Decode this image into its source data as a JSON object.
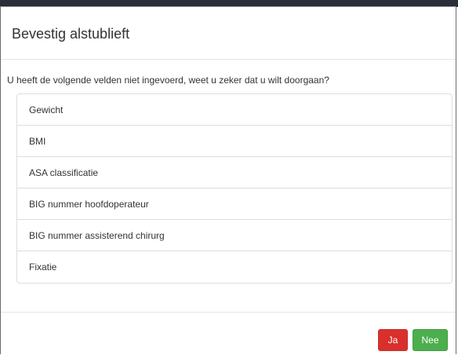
{
  "modal": {
    "title": "Bevestig alstublieft",
    "intro": "U heeft de volgende velden niet ingevoerd, weet u zeker dat u wilt doorgaan?",
    "fields": [
      "Gewicht",
      "BMI",
      "ASA classificatie",
      "BIG nummer hoofdoperateur",
      "BIG nummer assisterend chirurg",
      "Fixatie"
    ],
    "buttons": {
      "yes": "Ja",
      "no": "Nee"
    }
  },
  "colors": {
    "yes_button": "#d9302c",
    "no_button": "#4cae4c"
  }
}
